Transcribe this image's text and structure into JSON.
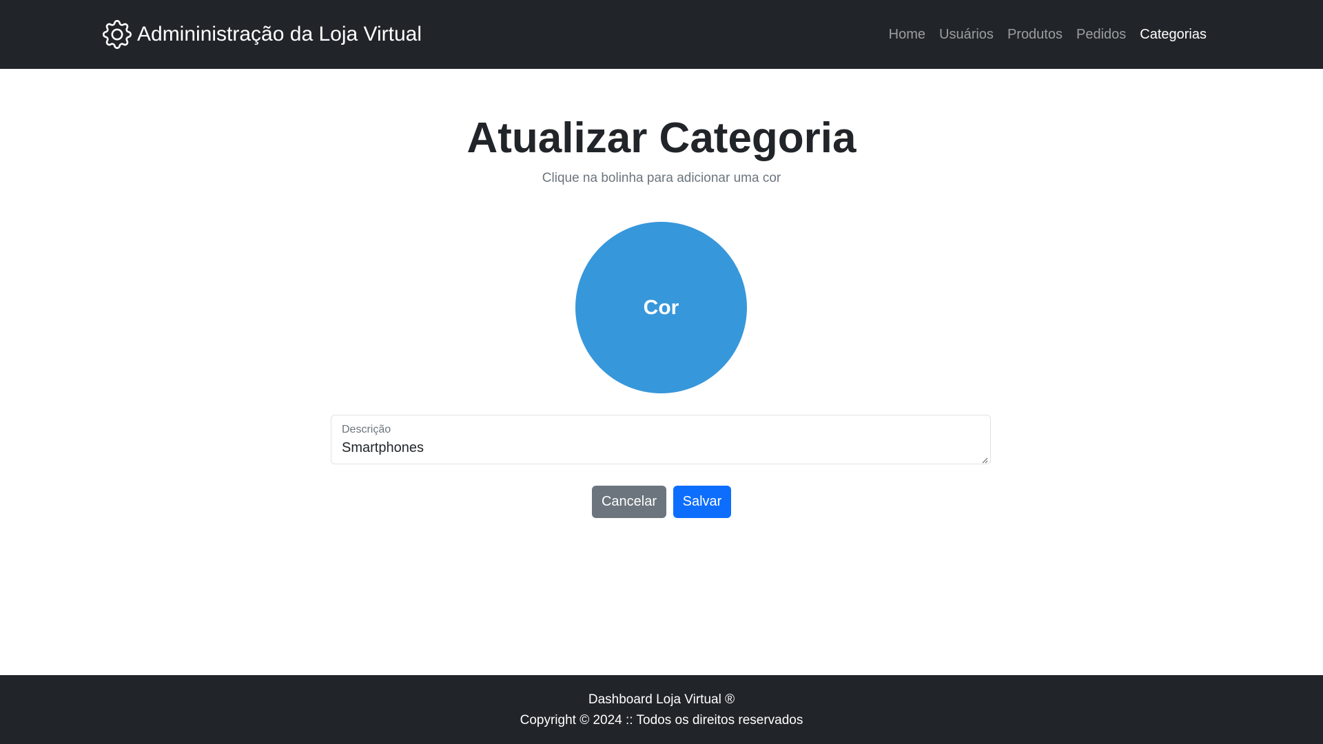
{
  "navbar": {
    "brand_label": "Admininistração da Loja Virtual",
    "brand_icon": "gear-icon",
    "links": [
      {
        "label": "Home",
        "active": false
      },
      {
        "label": "Usuários",
        "active": false
      },
      {
        "label": "Produtos",
        "active": false
      },
      {
        "label": "Pedidos",
        "active": false
      },
      {
        "label": "Categorias",
        "active": true
      }
    ]
  },
  "main": {
    "title": "Atualizar Categoria",
    "subtitle": "Clique na bolinha para adicionar uma cor",
    "color_picker": {
      "label": "Cor",
      "color": "#3797db"
    },
    "description_field": {
      "label": "Descrição",
      "value": "Smartphones"
    },
    "buttons": {
      "cancel_label": "Cancelar",
      "save_label": "Salvar"
    }
  },
  "footer": {
    "line1": "Dashboard Loja Virtual ®",
    "line2": "Copyright © 2024 :: Todos os direitos reservados"
  },
  "colors": {
    "navbar_bg": "#212529",
    "cancel_bg": "#6c757d",
    "save_bg": "#0d6efd"
  }
}
